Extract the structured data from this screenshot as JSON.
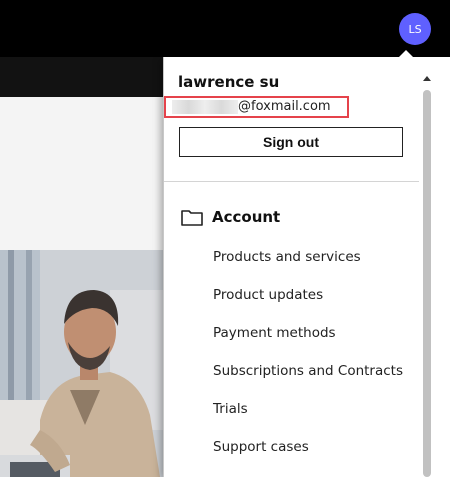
{
  "header": {
    "avatar_initials": "LS"
  },
  "account_menu": {
    "user_name": "lawrence su",
    "email_visible": "@foxmail.com",
    "sign_out_label": "Sign out",
    "section_icon": "folder-icon",
    "section_title": "Account",
    "items": [
      {
        "label": "Products and services"
      },
      {
        "label": "Product updates"
      },
      {
        "label": "Payment methods"
      },
      {
        "label": "Subscriptions and Contracts"
      },
      {
        "label": "Trials"
      },
      {
        "label": "Support cases"
      }
    ]
  },
  "colors": {
    "avatar_bg": "#5f60ff",
    "highlight_border": "#e5434b",
    "topbar": "#000000"
  }
}
